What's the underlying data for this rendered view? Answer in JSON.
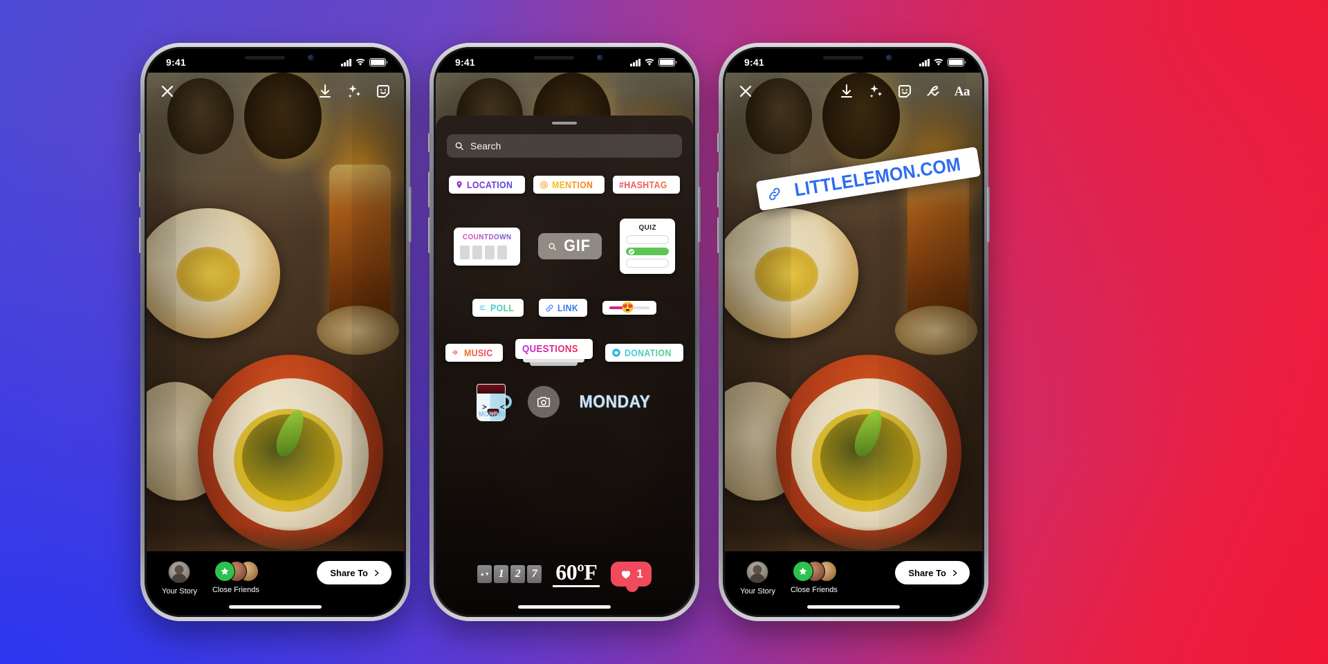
{
  "background": {
    "from": "#4b49d6",
    "to": "#ee1b38"
  },
  "status_bar": {
    "time": "9:41",
    "signal_icon": "cellular-bars-icon",
    "wifi_icon": "wifi-icon",
    "battery_icon": "battery-icon"
  },
  "toolbar": {
    "close_icon": "close-icon",
    "save_icon": "download-icon",
    "effects_icon": "sparkles-icon",
    "sticker_icon": "sticker-smiley-icon",
    "draw_icon": "squiggle-draw-icon",
    "text_icon": "Aa"
  },
  "share_bar": {
    "your_story_label": "Your Story",
    "close_friends_label": "Close Friends",
    "share_to_label": "Share To",
    "chevron_icon": "chevron-right-icon",
    "avatar_icon": "avatar",
    "star_icon": "star-icon"
  },
  "sticker_tray": {
    "grabber": "drag-handle",
    "search": {
      "placeholder": "Search",
      "icon": "search-icon"
    },
    "row1": [
      {
        "name": "location",
        "label": "LOCATION",
        "icon": "pin-icon"
      },
      {
        "name": "mention",
        "label": "MENTION",
        "icon": "at-icon"
      },
      {
        "name": "hashtag",
        "label": "HASHTAG",
        "icon": "hash-icon"
      }
    ],
    "row2": {
      "countdown": {
        "label": "COUNTDOWN",
        "digits": [
          "",
          "",
          "",
          ""
        ]
      },
      "gif": {
        "label": "GIF",
        "icon": "search-icon"
      },
      "quiz": {
        "label": "QUIZ",
        "options": 3,
        "selected_index": 1,
        "check_icon": "check-icon"
      }
    },
    "row3": {
      "poll": {
        "label": "POLL",
        "icon": "poll-bars-icon"
      },
      "link": {
        "label": "LINK",
        "icon": "chain-link-icon"
      },
      "slider": {
        "emoji": "😍",
        "fill_percent": 52
      }
    },
    "row4": {
      "music": {
        "label": "MUSIC",
        "icon": "equalizer-icon"
      },
      "questions": {
        "label": "QUESTIONS"
      },
      "donation": {
        "label": "DONATION",
        "icon": "heart-circle-icon"
      }
    },
    "row5": {
      "mug_sticker": {
        "label": "MONDAY",
        "eye_left": "&gt;",
        "eye_right": "&gt;"
      },
      "camera": {
        "icon": "camera-icon"
      },
      "monday_text": "MONDAY"
    },
    "row6": {
      "counter": {
        "digits": [
          "1",
          "1",
          "2",
          "7"
        ],
        "small_glyph": "▲▼"
      },
      "temperature": "60ºF",
      "like": {
        "count": "1",
        "icon": "heart-icon"
      }
    }
  },
  "link_sticker": {
    "label": "LITTLELEMON.COM",
    "icon": "chain-link-icon",
    "color": "#2d6cf0"
  }
}
